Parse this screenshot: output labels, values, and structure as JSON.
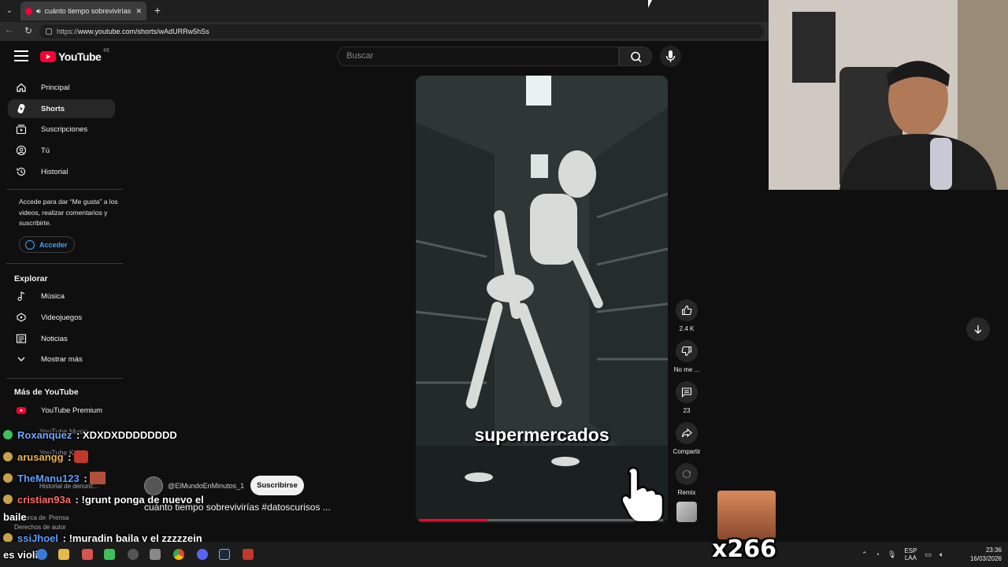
{
  "browser": {
    "tab_title": "cuánto tiempo sobrevivirías #",
    "new_tab": "+",
    "url_prefix": "https://",
    "url_rest": "www.youtube.com/shorts/wAdURRw5hSs"
  },
  "header": {
    "logo_text": "YouTube",
    "logo_country": "PE",
    "search_placeholder": "Buscar"
  },
  "sidebar": {
    "items": [
      {
        "label": "Principal",
        "icon": "home-icon"
      },
      {
        "label": "Shorts",
        "icon": "shorts-icon"
      },
      {
        "label": "Suscripciones",
        "icon": "subscriptions-icon"
      },
      {
        "label": "Tú",
        "icon": "you-icon"
      },
      {
        "label": "Historial",
        "icon": "history-icon"
      }
    ],
    "signin_text": "Accede para dar “Me gusta” a los videos, realizar comentarios y suscribirte.",
    "signin_button": "Acceder",
    "explore_title": "Explorar",
    "explore": [
      {
        "label": "Música",
        "icon": "music-icon"
      },
      {
        "label": "Videojuegos",
        "icon": "gaming-icon"
      },
      {
        "label": "Noticias",
        "icon": "news-icon"
      },
      {
        "label": "Mostrar más",
        "icon": "chevron-down-icon"
      }
    ],
    "more_title": "Más de YouTube",
    "more": [
      {
        "label": "YouTube Premium",
        "icon": "youtube-premium-icon"
      },
      {
        "label": "YouTube Music"
      },
      {
        "label": "YouTube Kids"
      }
    ],
    "footer": [
      "Historial de denunc...",
      "Acerca de",
      "Prensa",
      "Derechos de autor"
    ]
  },
  "video": {
    "caption": "supermercados",
    "progress": 0.28,
    "channel": "@ElMundoEnMinutos_1",
    "subscribe": "Suscribirse",
    "title": "cuánto tiempo sobrevivirías #datoscurisos ..."
  },
  "actions": {
    "likes": "2.4 K",
    "dislike": "No me ...",
    "comments": "23",
    "share": "Compartir",
    "remix": "Remix"
  },
  "chat": [
    {
      "user": "Roxanquez",
      "sep": " : ",
      "msg": "XDXDXDDDDDDDD",
      "color": "#6fa8ff",
      "badge": "#3fbf5a"
    },
    {
      "user": "arusangg",
      "sep": " : ",
      "msg": "",
      "color": "#f0b840",
      "badge": "#c8a24a"
    },
    {
      "user": "TheManu123",
      "sep": " : ",
      "msg": "",
      "color": "#5aa0ff",
      "badge": "#c8a24a"
    },
    {
      "user": "cristian93a",
      "sep": " : ",
      "msg": "!grunt ponga de nuevo el",
      "color": "#ff6a6a",
      "badge": "#c8a24a"
    },
    {
      "user": "",
      "sep": "",
      "msg": "baile",
      "color": "#fff"
    },
    {
      "user": "ssjJhoel",
      "sep": " : ",
      "msg": "!muradin baila y el zzzzzein",
      "color": "#5aa0ff",
      "badge": "#c8a24a"
    },
    {
      "user": "",
      "sep": "",
      "msg": "es violin",
      "color": "#fff"
    }
  ],
  "emote": {
    "count": "x266"
  },
  "taskbar": {
    "lang_top": "ESP",
    "lang_bottom": "LAA",
    "time": "23:36",
    "date": "16/03/2026"
  },
  "colors": {
    "accent": "#ff0033",
    "link": "#3ea6ff",
    "bg": "#0f0f0f"
  }
}
